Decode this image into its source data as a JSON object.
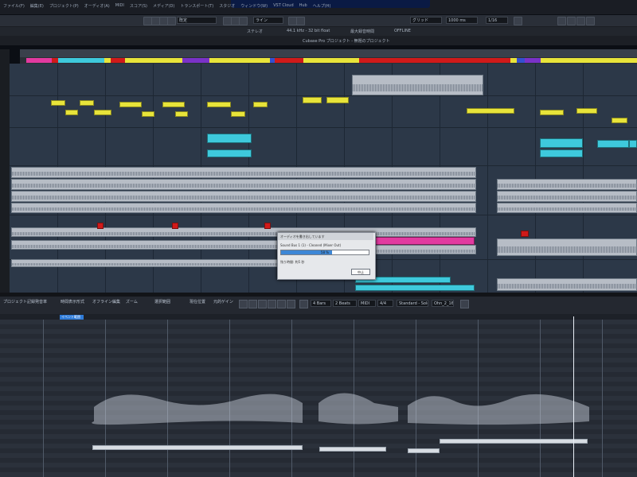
{
  "window": {
    "menu": [
      "ファイル(F)",
      "編集(E)",
      "プロジェクト(P)",
      "オーディオ(A)",
      "MIDI",
      "スコア(S)",
      "メディア(D)",
      "トランスポート(T)",
      "スタジオ",
      "ウィンドウ(W)",
      "VST Cloud",
      "Hub",
      "ヘルプ(H)"
    ],
    "project_title": "Cubase Pro プロジェクト - 無題のプロジェクト"
  },
  "toolbar": {
    "snap_type": "ライン",
    "grid_type": "グリッド",
    "quantize": "1/16",
    "zoom_value": "1000 ms",
    "dropdown_default": "既定",
    "status_items": [
      "ステレオ",
      "44.1 kHz - 32 bit float",
      "最大録音時間",
      "OFFLINE"
    ]
  },
  "tracks": {
    "colors": {
      "yellow": "#e8e43a",
      "cyan": "#3ec9dc",
      "red": "#d01a1a",
      "pink": "#e23aa0",
      "purple": "#7a32c8",
      "blue": "#3550d0",
      "background": "#2c3848"
    }
  },
  "dialog": {
    "title": "オーディオを書き出しています",
    "message": "Sound Bus 1 (1) - Cleaned (Mixer Out)",
    "progress_percent": 58,
    "progress_label": "58 %",
    "remaining": "残り時間: 約5 秒",
    "cancel_label": "中止"
  },
  "lower_zone": {
    "tabs": [
      "プロジェクト記録",
      "発音率",
      "時間表示形式",
      "オフライン編集",
      "ズーム",
      "選択範囲",
      "現在位置",
      "元的ゲイン"
    ],
    "selection_label": "イベント範囲",
    "fields": {
      "snap": "4 Bars",
      "quantize": "2 Beats",
      "value": "MIDI",
      "algo_label": "4/4",
      "warp_mode": "Standard - Solo",
      "event_name": "Ohn_2_16"
    }
  }
}
